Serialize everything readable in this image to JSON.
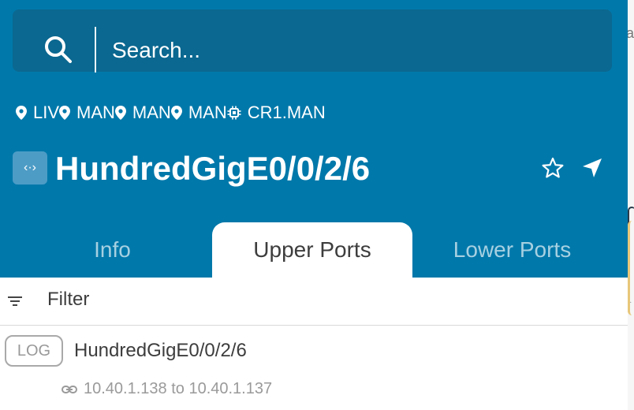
{
  "search": {
    "placeholder": "Search..."
  },
  "breadcrumbs": [
    {
      "label": "LIV",
      "icon": "map-pin-icon"
    },
    {
      "label": "MAN",
      "icon": "map-pin-icon"
    },
    {
      "label": "MAN",
      "icon": "map-pin-icon"
    },
    {
      "label": "MAN",
      "icon": "map-pin-icon"
    },
    {
      "label": "CR1.MAN",
      "icon": "chip-icon"
    }
  ],
  "header": {
    "title": "HundredGigE0/0/2/6",
    "icon_text": "‹·›",
    "icon": "interface-icon"
  },
  "tabs": [
    {
      "label": "Info",
      "active": false
    },
    {
      "label": "Upper Ports",
      "active": true
    },
    {
      "label": "Lower Ports",
      "active": false
    }
  ],
  "filter": {
    "label": "Filter"
  },
  "ports": [
    {
      "badge": "LOG",
      "name": "HundredGigE0/0/2/6",
      "address": "10.40.1.138 to 10.40.1.137"
    }
  ],
  "colors": {
    "header_bg": "#0078aa",
    "search_bg": "#0b6890",
    "icon_bg": "#4d9cc6"
  }
}
